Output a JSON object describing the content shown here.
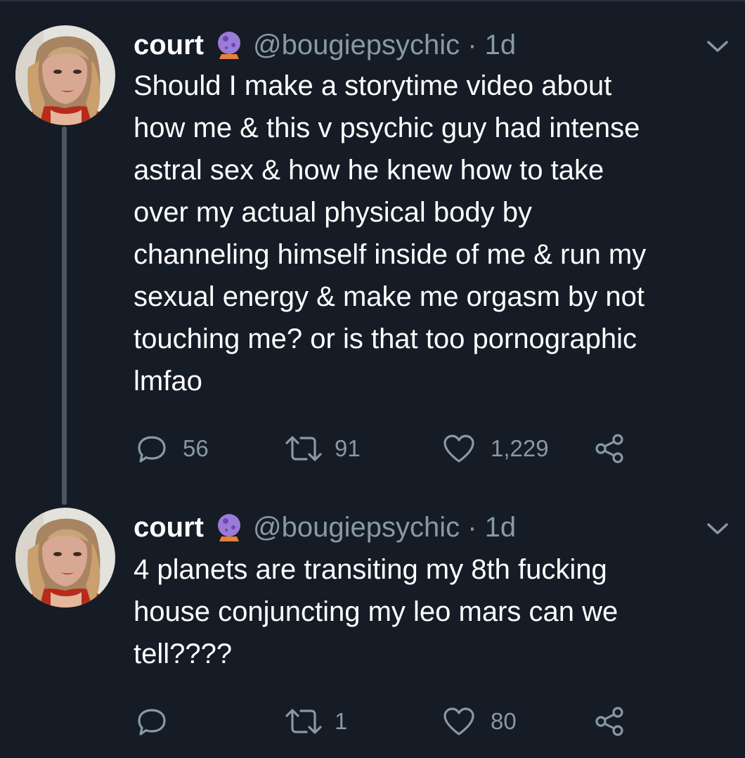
{
  "tweets": [
    {
      "name": "court",
      "handle": "@bougiepsychic · 1d",
      "lines": [
        "Should I make a storytime video about",
        "how me & this v psychic guy had intense",
        "astral sex & how he knew how to take",
        "over my actual physical body by",
        "channeling himself inside of me & run my",
        "sexual energy & make me orgasm by not",
        "touching me? or is that too pornographic",
        "lmfao"
      ],
      "replies": "56",
      "retweets": "91",
      "likes": "1,229"
    },
    {
      "name": "court",
      "handle": "@bougiepsychic · 1d",
      "lines": [
        "4 planets are transiting my 8th fucking",
        "house conjuncting my leo mars can we",
        "tell????"
      ],
      "replies": "",
      "retweets": "1",
      "likes": "80"
    }
  ],
  "icons": {
    "badge": "crystal-ball-icon",
    "reply": "reply-icon",
    "retweet": "retweet-icon",
    "like": "heart-icon",
    "share": "share-icon",
    "more": "chevron-down-icon"
  },
  "colors": {
    "background": "#151c26",
    "text": "#ffffff",
    "muted": "#8899a6",
    "thread_line": "#4a5563",
    "badge_purple": "#9c7bd6",
    "badge_base": "#e8803a"
  }
}
